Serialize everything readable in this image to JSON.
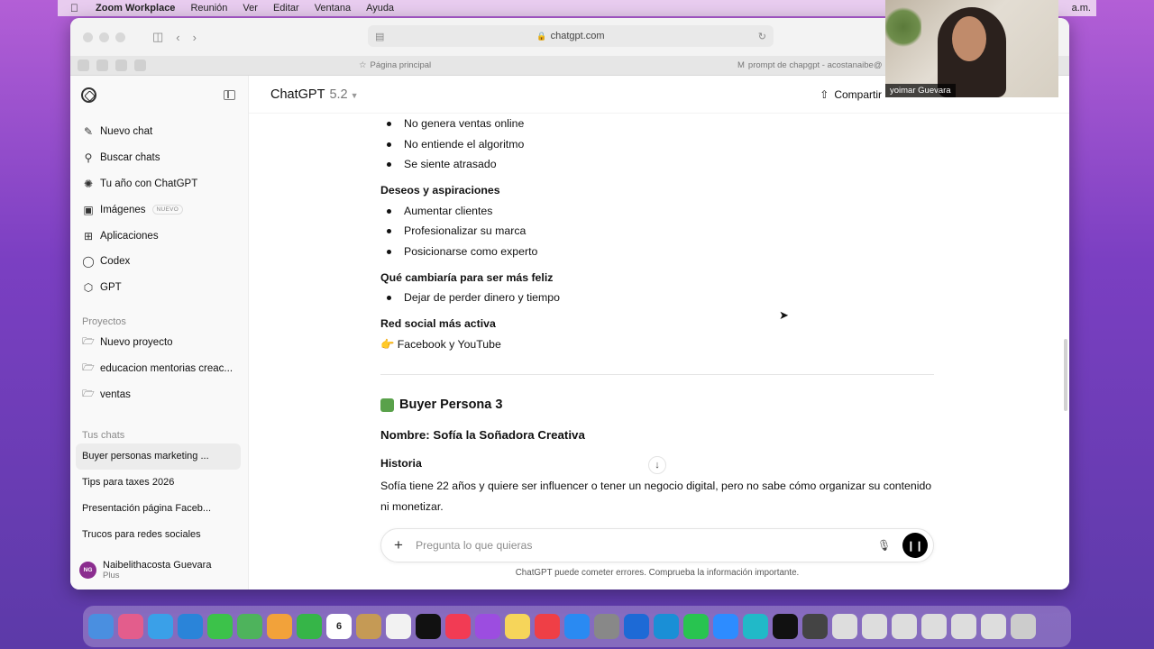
{
  "menubar": {
    "app": "Zoom Workplace",
    "items": [
      "Reunión",
      "Ver",
      "Editar",
      "Ventana",
      "Ayuda"
    ],
    "time": "a.m."
  },
  "browser": {
    "url": "chatgpt.com",
    "tabs": [
      "Página principal",
      "prompt de chapgpt - acostanaibe@"
    ]
  },
  "sidebar": {
    "nav": [
      {
        "label": "Nuevo chat",
        "icon": "edit-icon"
      },
      {
        "label": "Buscar chats",
        "icon": "search-icon"
      },
      {
        "label": "Tu año con ChatGPT",
        "icon": "sparkle-icon"
      },
      {
        "label": "Imágenes",
        "icon": "image-icon",
        "badge": "NUEVO"
      },
      {
        "label": "Aplicaciones",
        "icon": "grid-icon"
      },
      {
        "label": "Codex",
        "icon": "codex-icon"
      },
      {
        "label": "GPT",
        "icon": "cube-icon"
      }
    ],
    "projects_title": "Proyectos",
    "projects": [
      "Nuevo proyecto",
      "educacion mentorias creac...",
      "ventas"
    ],
    "chats_title": "Tus chats",
    "chats": [
      "Buyer personas marketing ...",
      "Tips para taxes 2026",
      "Presentación página Faceb...",
      "Trucos para redes sociales"
    ],
    "user": {
      "initials": "NG",
      "name": "Naibelithacosta Guevara",
      "plan": "Plus"
    }
  },
  "header": {
    "model": "ChatGPT",
    "version": "5.2",
    "share": "Compartir"
  },
  "content": {
    "bullets_a": [
      "No genera ventas online",
      "No entiende el algoritmo",
      "Se siente atrasado"
    ],
    "h_deseos": "Deseos y aspiraciones",
    "bullets_b": [
      "Aumentar clientes",
      "Profesionalizar su marca",
      "Posicionarse como experto"
    ],
    "h_feliz": "Qué cambiaría para ser más feliz",
    "bullets_c": [
      "Dejar de perder dinero y tiempo"
    ],
    "h_red": "Red social más activa",
    "red_value": "👉 Facebook y YouTube",
    "persona_title": "Buyer Persona 3",
    "nombre": "Nombre: Sofía la Soñadora Creativa",
    "historia_title": "Historia",
    "historia_text": "Sofía tiene 22 años y quiere ser influencer o tener un negocio digital, pero no sabe cómo organizar su contenido ni monetizar."
  },
  "composer": {
    "placeholder": "Pregunta lo que quieras"
  },
  "disclaimer": "ChatGPT puede cometer errores. Comprueba la información importante.",
  "webcam": {
    "name": "yoimar Guevara"
  },
  "dock_calendar_day": "6"
}
